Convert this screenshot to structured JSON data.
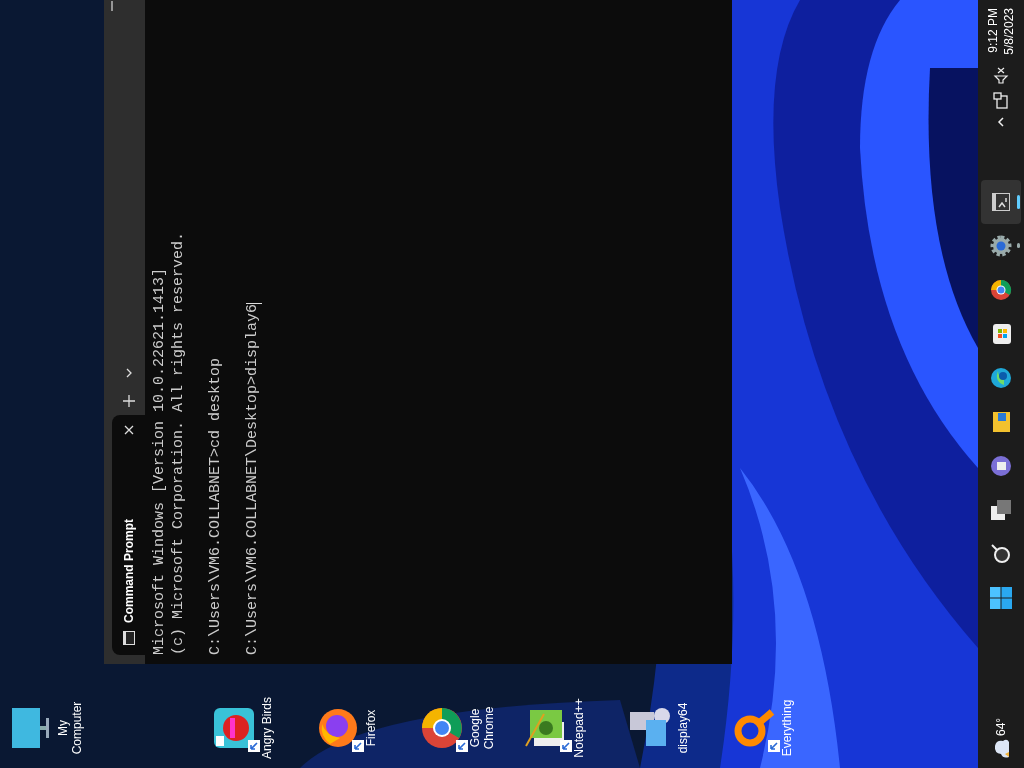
{
  "desktop_icons": [
    {
      "kind": "computer",
      "label": "My Computer",
      "shortcut": false
    },
    {
      "kind": "game",
      "label": "Angry Birds",
      "shortcut": true
    },
    {
      "kind": "firefox",
      "label": "Firefox",
      "shortcut": true
    },
    {
      "kind": "chrome",
      "label": "Google Chrome",
      "shortcut": true
    },
    {
      "kind": "notepad",
      "label": "Notepad++",
      "shortcut": true
    },
    {
      "kind": "display",
      "label": "display64",
      "shortcut": false
    },
    {
      "kind": "search",
      "label": "Everything",
      "shortcut": true
    }
  ],
  "terminal": {
    "tab": {
      "title": "Command Prompt",
      "selected": true
    },
    "blocks": [
      [
        "Microsoft Windows [Version 10.0.22621.1413]",
        "(c) Microsoft Corporation. All rights reserved."
      ],
      [
        "C:\\Users\\VM6.COLLABNET>cd desktop"
      ],
      [
        "C:\\Users\\VM6.COLLABNET\\Desktop>display6"
      ]
    ]
  },
  "taskbar": {
    "weather": "64°",
    "apps": [
      {
        "kind": "start",
        "running": false,
        "selected": false
      },
      {
        "kind": "search",
        "running": false,
        "selected": false
      },
      {
        "kind": "taskview",
        "running": false,
        "selected": false
      },
      {
        "kind": "chat",
        "running": false,
        "selected": false
      },
      {
        "kind": "folder",
        "running": false,
        "selected": false
      },
      {
        "kind": "edge",
        "running": false,
        "selected": false
      },
      {
        "kind": "store",
        "running": false,
        "selected": false
      },
      {
        "kind": "chrome",
        "running": false,
        "selected": false
      },
      {
        "kind": "settings",
        "running": true,
        "selected": false
      },
      {
        "kind": "terminal",
        "running": true,
        "selected": true
      }
    ],
    "time": "9:12 PM",
    "date": "5/8/2023"
  }
}
